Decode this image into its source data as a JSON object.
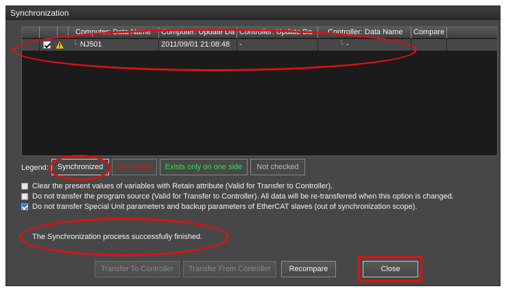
{
  "window": {
    "title": "Synchronization"
  },
  "grid": {
    "headers": [
      "Computer: Data Name",
      "Computer: Update Da",
      "Controller: Update Da",
      "Controller: Data Name",
      "Compare"
    ],
    "rows": [
      {
        "checked": true,
        "warning_icon": "warning-triangle-icon",
        "computer_data_name": "NJ501",
        "computer_update": "2011/09/01 21:08:48",
        "controller_update": "-",
        "controller_data_name": "-",
        "compare": ""
      }
    ]
  },
  "legend": {
    "label": "Legend:",
    "items": [
      {
        "label": "Synchronized",
        "color": "#f8f8f8"
      },
      {
        "label": "Difference",
        "color": "#c02020"
      },
      {
        "label": "Exists only on one side",
        "color": "#37e04e"
      },
      {
        "label": "Not checked",
        "color": "#bcbcbc"
      }
    ]
  },
  "options": [
    {
      "checked": false,
      "label": "Clear the present values of variables with Retain attribute (Valid for Transfer to Controller)."
    },
    {
      "checked": false,
      "label": "Do not transfer the program source (Valid for Transfer to Controller). All data will be re-transferred when this option is changed."
    },
    {
      "checked": true,
      "label": "Do not transfer Special Unit parameters and backup parameters of EtherCAT slaves (out of synchronization scope)."
    }
  ],
  "status": "The Synchronization process successfully finished.",
  "buttons": {
    "transfer_to": "Transfer To Controller",
    "transfer_from": "Transfer From Controller",
    "recompare": "Recompare",
    "close": "Close"
  },
  "annotation_color": "#e01010"
}
